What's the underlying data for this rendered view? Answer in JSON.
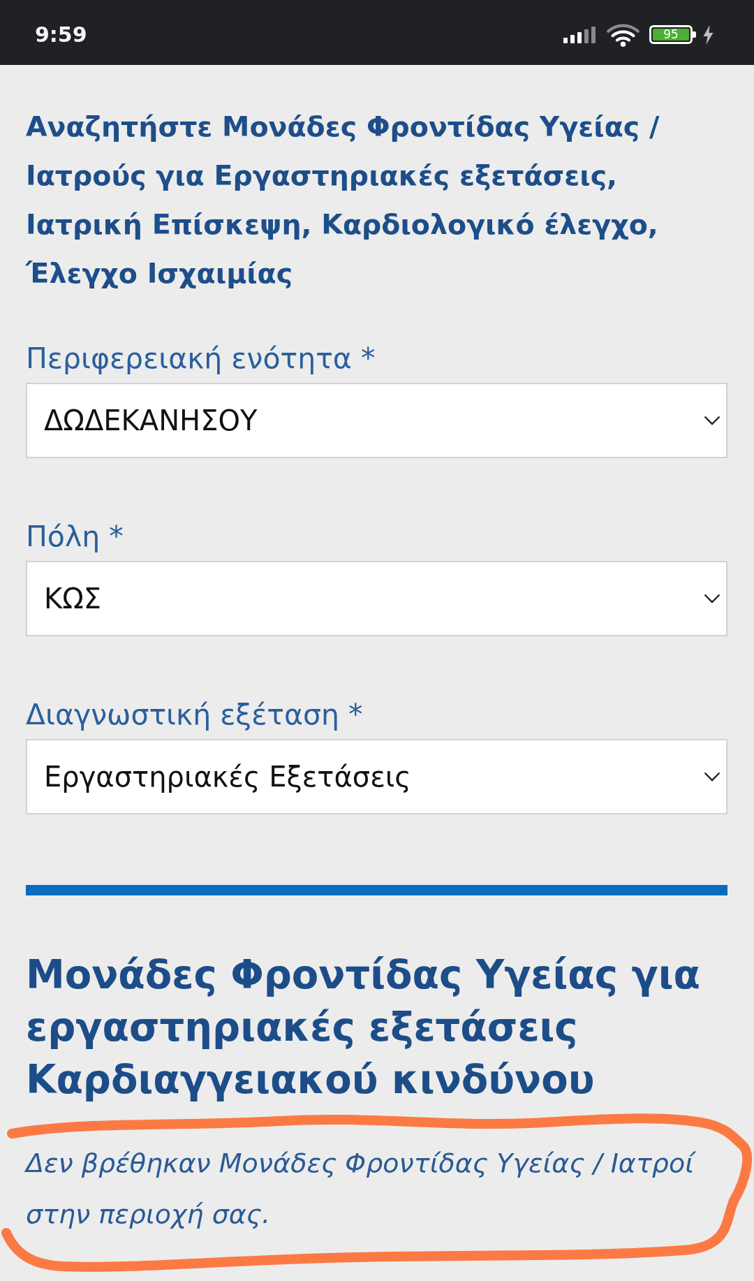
{
  "status_bar": {
    "time": "9:59",
    "battery": "95"
  },
  "search_title": "Αναζητήστε Μονάδες Φροντίδας Υγείας / Ιατρούς για Εργαστηριακές εξετάσεις, Ιατρική Επίσκεψη, Καρδιολογικό έλεγχο, Έλεγχο Ισχαιμίας",
  "fields": [
    {
      "label": "Περιφερειακή ενότητα *",
      "value": "ΔΩΔΕΚΑΝΗΣΟΥ"
    },
    {
      "label": "Πόλη *",
      "value": "ΚΩΣ"
    },
    {
      "label": "Διαγνωστική εξέταση *",
      "value": "Εργαστηριακές Εξετάσεις"
    }
  ],
  "results": {
    "title": "Μονάδες Φροντίδας Υγείας για εργαστηριακές εξετάσεις Καρδιαγγειακού κινδύνου",
    "message": "Δεν βρέθηκαν Μονάδες Φροντίδας Υγείας / Ιατροί στην περιοχή σας."
  }
}
